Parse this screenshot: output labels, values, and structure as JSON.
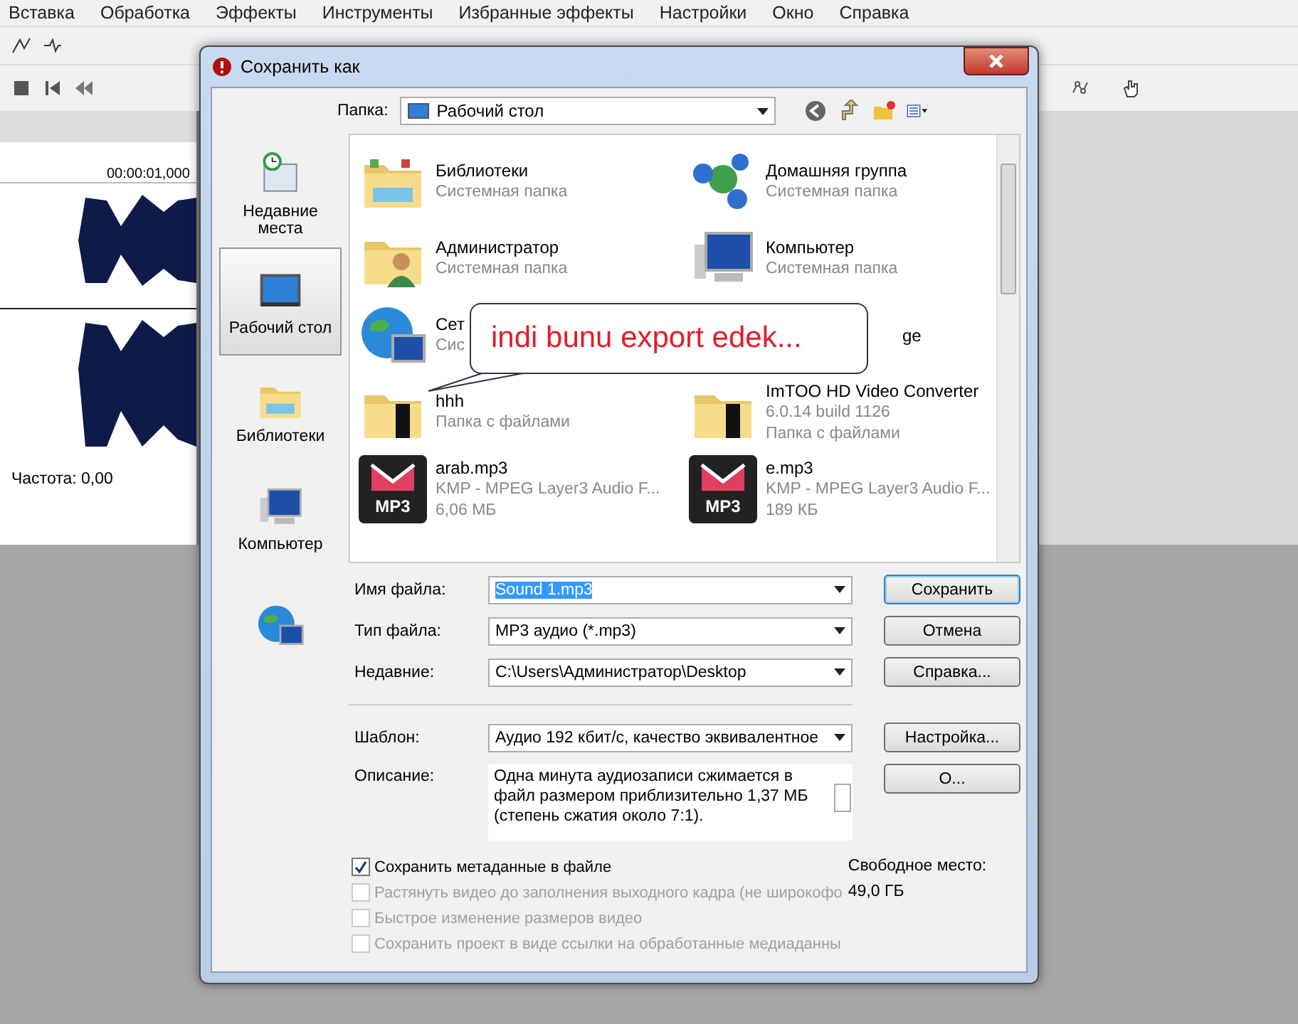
{
  "app": {
    "menu": [
      "Вставка",
      "Обработка",
      "Эффекты",
      "Инструменты",
      "Избранные эффекты",
      "Настройки",
      "Окно",
      "Справка"
    ],
    "ruler_time": "00:00:01,000",
    "status": "Частота: 0,00"
  },
  "dialog": {
    "title": "Сохранить как",
    "folder_label": "Папка:",
    "folder": "Рабочий стол",
    "places": [
      {
        "label": "Недавние места",
        "kind": "recent",
        "selected": false
      },
      {
        "label": "Рабочий стол",
        "kind": "desktop",
        "selected": true
      },
      {
        "label": "Библиотеки",
        "kind": "library",
        "selected": false
      },
      {
        "label": "Компьютер",
        "kind": "computer",
        "selected": false
      },
      {
        "kind": "network",
        "selected": false
      }
    ],
    "files": [
      {
        "name": "Библиотеки",
        "details": [
          "Системная папка"
        ],
        "kind": "library"
      },
      {
        "name": "Домашняя группа",
        "details": [
          "Системная папка"
        ],
        "kind": "homegroup"
      },
      {
        "name": "Администратор",
        "details": [
          "Системная папка"
        ],
        "kind": "user"
      },
      {
        "name": "Компьютер",
        "details": [
          "Системная папка"
        ],
        "kind": "computer"
      },
      {
        "name": "Сет",
        "details": [
          "Сис"
        ],
        "kind": "network"
      },
      {
        "name": "ge",
        "kind": "covered"
      },
      {
        "name": "hhh",
        "details": [
          "Папка с файлами"
        ],
        "kind": "video-folder"
      },
      {
        "name": "ImTOO HD Video Converter",
        "details": [
          "6.0.14 build 1126",
          "Папка с файлами"
        ],
        "kind": "video-folder"
      },
      {
        "name": "arab.mp3",
        "details": [
          "KMP - MPEG Layer3 Audio F...",
          "6,06 МБ"
        ],
        "kind": "mp3",
        "badge": "MP3"
      },
      {
        "name": "e.mp3",
        "details": [
          "KMP - MPEG Layer3 Audio F...",
          "189 КБ"
        ],
        "kind": "mp3",
        "badge": "MP3"
      }
    ],
    "callout": "indi bunu export edek...",
    "fields": [
      {
        "label": "Имя файла:",
        "value": "Sound 1.mp3",
        "text_selected": true,
        "button": {
          "label": "Сохранить",
          "default": true
        }
      },
      {
        "label": "Тип файла:",
        "value": "MP3 аудио (*.mp3)",
        "text_selected": false,
        "button": {
          "label": "Отмена",
          "default": false
        }
      },
      {
        "label": "Недавние:",
        "value": "C:\\Users\\Администратор\\Desktop",
        "text_selected": false,
        "button": {
          "label": "Справка...",
          "default": false
        }
      },
      {
        "label": "Шаблон:",
        "value": "Аудио 192 кбит/с, качество эквивалентное",
        "text_selected": false,
        "button": {
          "label": "Настройка...",
          "default": false
        }
      }
    ],
    "description": {
      "label": "Описание:",
      "text": "Одна минута аудиозаписи сжимается в файл размером приблизительно 1,37 МБ (степень сжатия около 7:1).",
      "button": "О..."
    },
    "checkboxes": [
      {
        "label": "Сохранить метаданные в файле",
        "checked": true,
        "disabled": false
      },
      {
        "label": "Растянуть видео до заполнения выходного кадра (не широкофо",
        "checked": false,
        "disabled": true
      },
      {
        "label": "Быстрое изменение размеров видео",
        "checked": false,
        "disabled": true
      },
      {
        "label": "Сохранить проект в виде ссылки на обработанные медиаданны",
        "checked": false,
        "disabled": true
      }
    ],
    "free_space": {
      "label": "Свободное место:",
      "value": "49,0 ГБ"
    }
  }
}
